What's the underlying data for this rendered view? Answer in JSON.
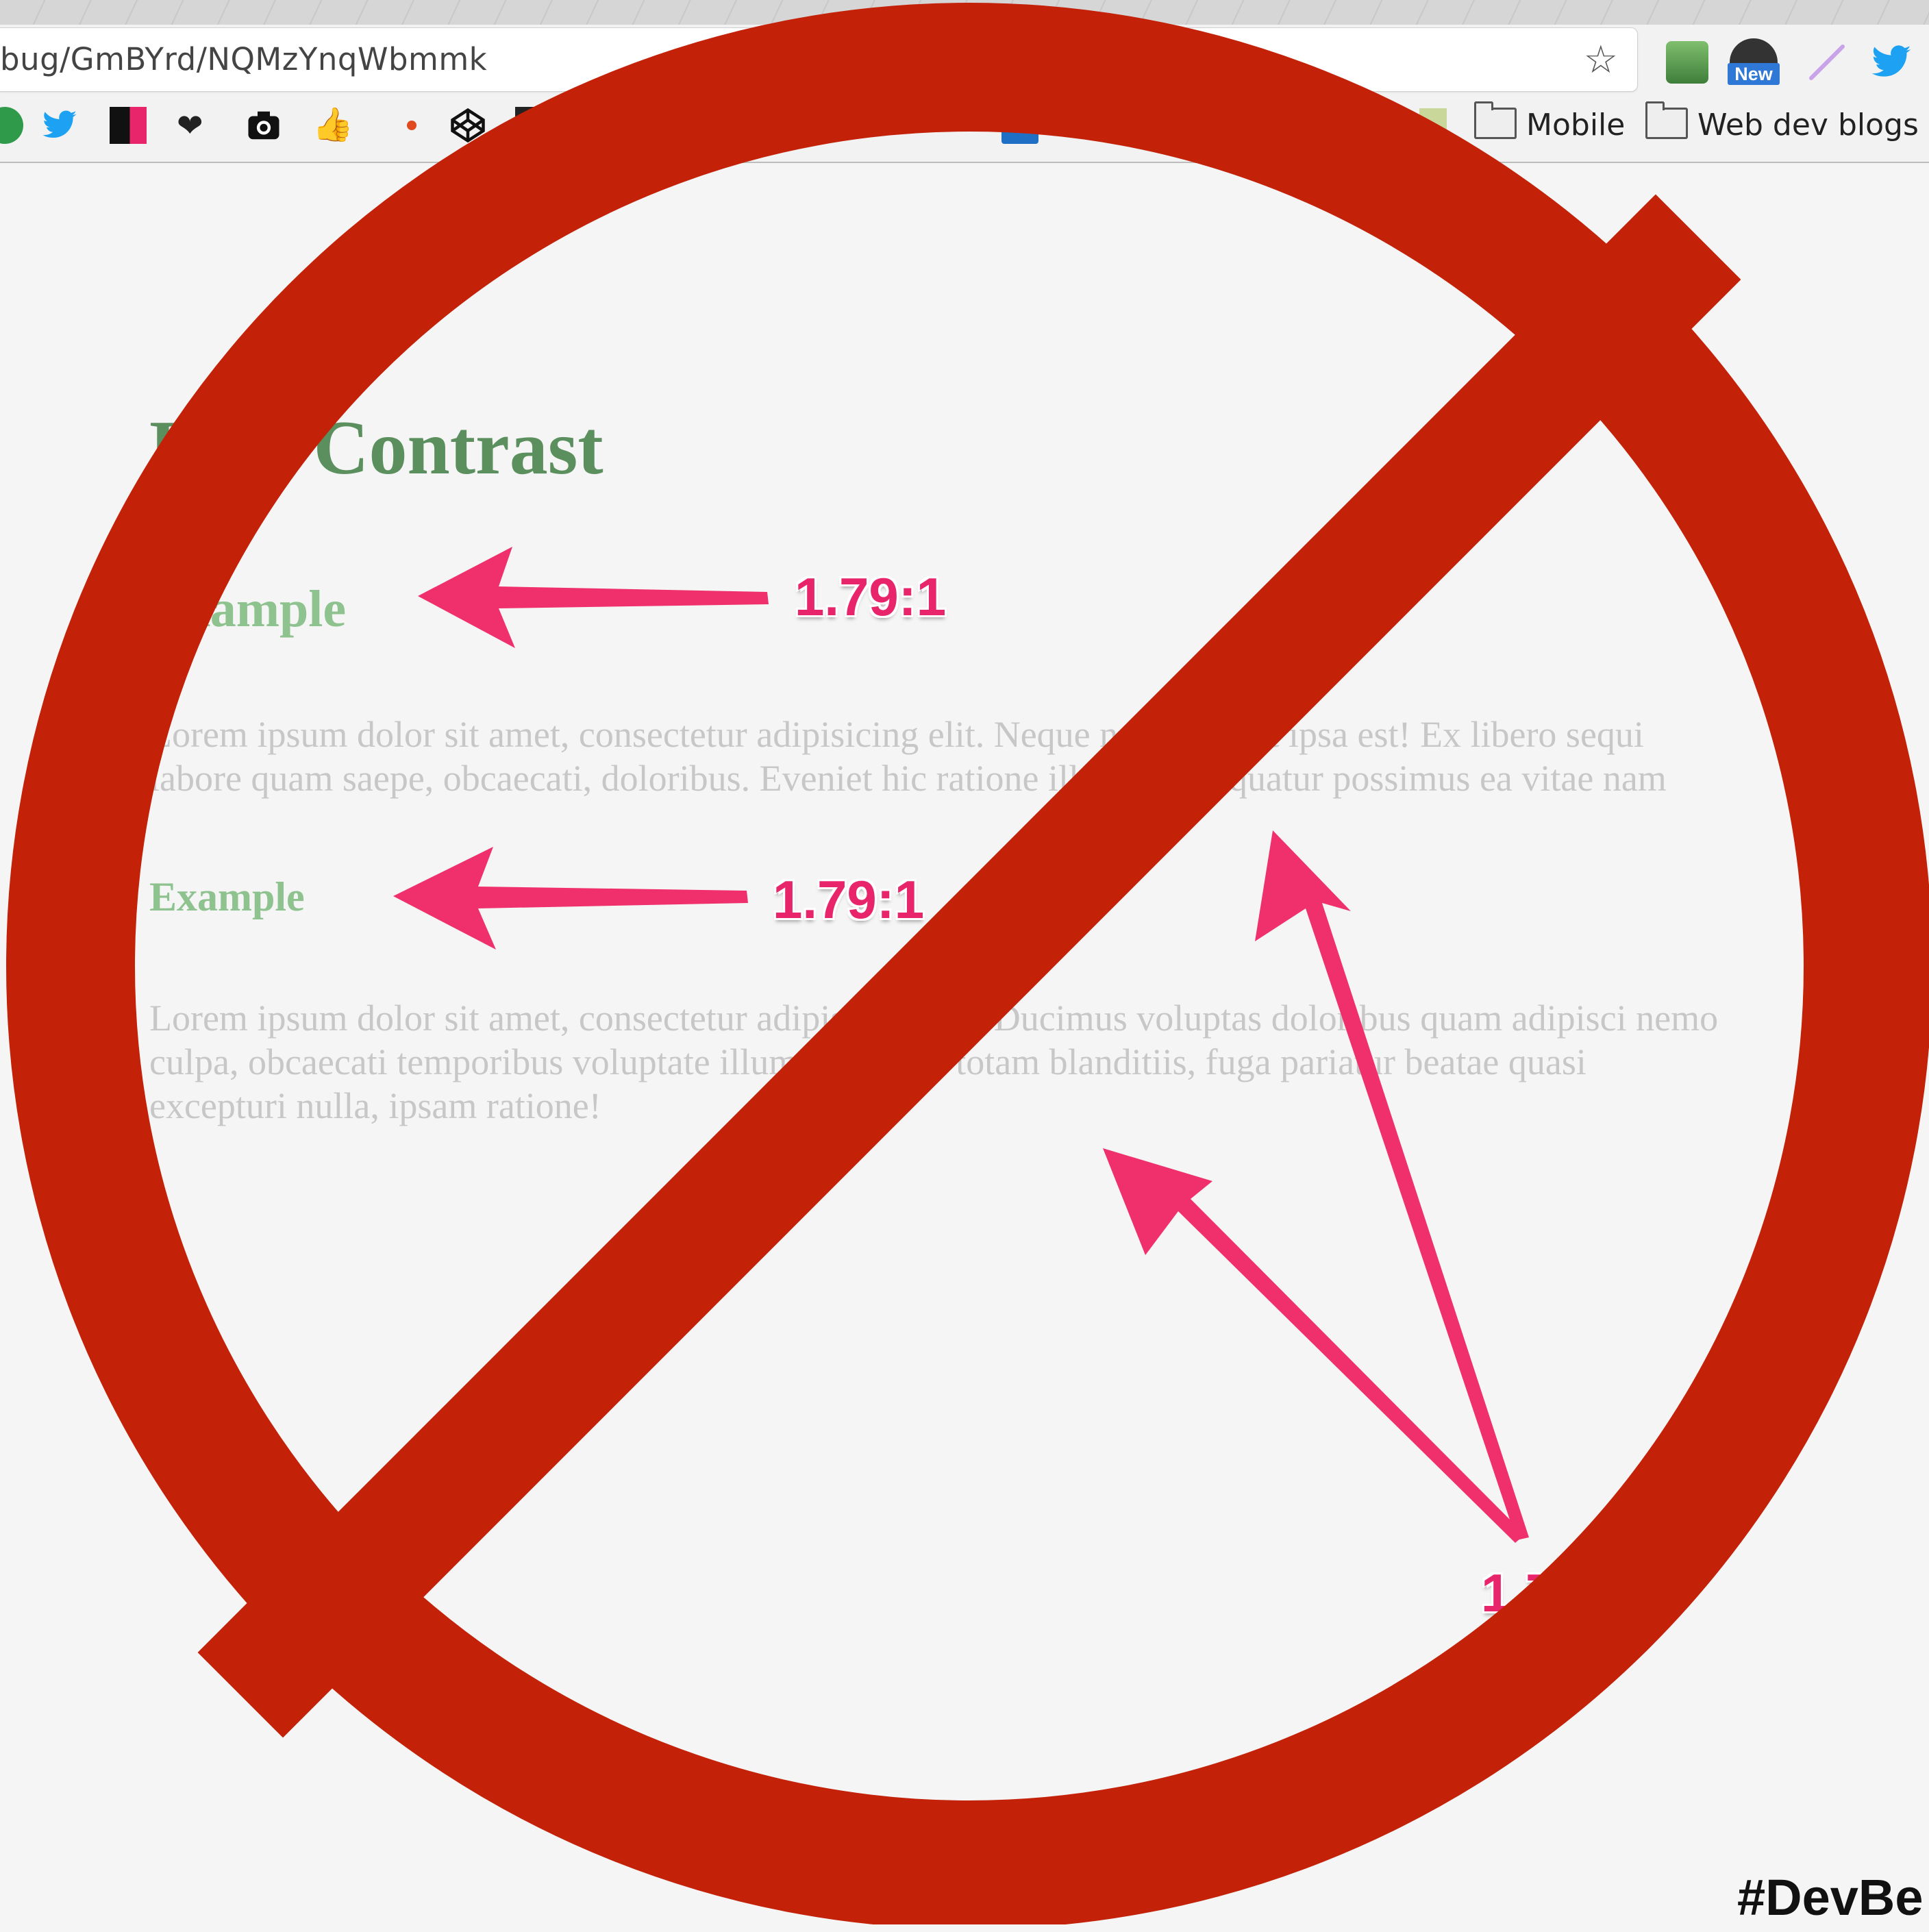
{
  "browser": {
    "url": "bug/GmBYrd/NQMzYnqWbmmk",
    "extension_badge": "New",
    "bookmark_folders": [
      "Mobile",
      "Web dev blogs"
    ]
  },
  "page": {
    "title": "Low Contrast",
    "heading_one": "Example",
    "paragraph_one": [
      "Lorem ipsum dolor sit amet, consectetur adipisicing elit. Neque nam eveniet ipsa est! Ex libero sequi",
      "labore quam saepe, obcaecati, doloribus. Eveniet hic ratione illum, consequatur possimus ea vitae nam"
    ],
    "heading_two": "Example",
    "paragraph_two": [
      "Lorem ipsum dolor sit amet, consectetur adipisicing elit. Ducimus voluptas doloribus quam adipisci nemo",
      "culpa, obcaecati temporibus voluptate illum molestias totam blanditiis, fuga pariatur beatae quasi",
      "excepturi nulla, ipsam ratione!"
    ]
  },
  "annotations": {
    "ratio_one": "1.79:1",
    "ratio_two": "1.79:1",
    "ratio_three": "1.79:1",
    "arrow_color": "#f0306c"
  },
  "overlay": {
    "symbol": "prohibition-sign",
    "color": "#c42109"
  },
  "hashtag": "#DevBe"
}
